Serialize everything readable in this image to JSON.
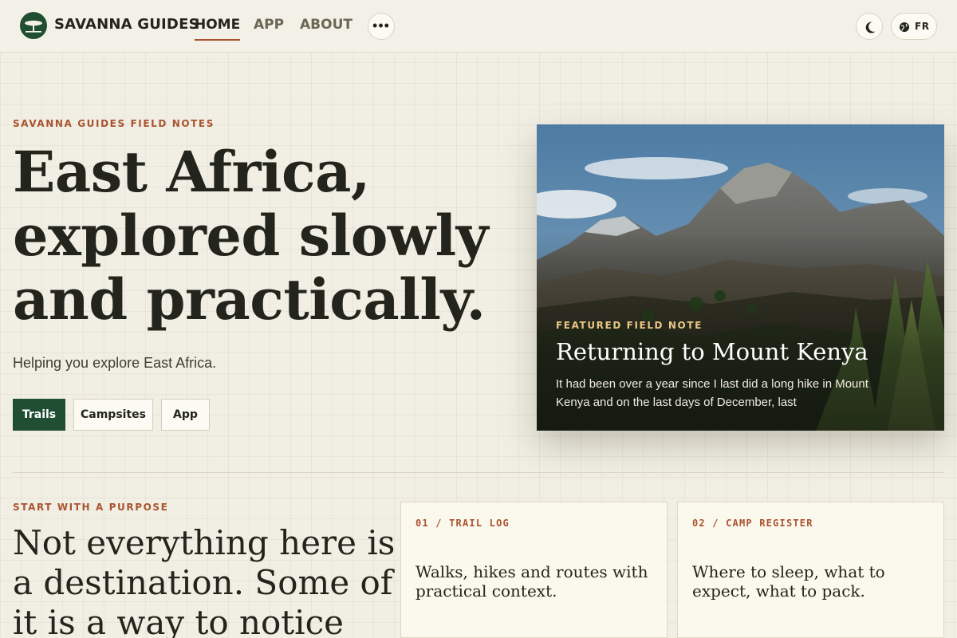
{
  "header": {
    "brand": "SAVANNA GUIDES",
    "nav": [
      {
        "label": "HOME",
        "active": true
      },
      {
        "label": "APP",
        "active": false
      },
      {
        "label": "ABOUT",
        "active": false
      }
    ],
    "more_label": "•••",
    "lang_label": "FR",
    "icons": {
      "logo": "acacia-tree-icon",
      "theme": "moon-icon",
      "lang": "globe-icon",
      "more": "ellipsis-icon"
    }
  },
  "hero": {
    "eyebrow": "SAVANNA GUIDES FIELD NOTES",
    "title_lines": [
      "East Africa,",
      "explored slowly",
      "and practically."
    ],
    "subtitle": "Helping you explore East Africa.",
    "buttons": [
      "Trails",
      "Campsites",
      "App"
    ]
  },
  "featured": {
    "eyebrow": "FEATURED FIELD NOTE",
    "title": "Returning to Mount Kenya",
    "excerpt": "It had been over a year since I last did a long hike in Mount Kenya and on the last days of December, last"
  },
  "purpose": {
    "eyebrow": "START WITH A PURPOSE",
    "lines": [
      "Not everything here is",
      "a destination. Some of",
      "it is a way to notice"
    ]
  },
  "cards": [
    {
      "eyebrow": "01 / TRAIL LOG",
      "text": "Walks, hikes and routes with practical context."
    },
    {
      "eyebrow": "02 / CAMP REGISTER",
      "text": "Where to sleep, what to expect, what to pack."
    }
  ],
  "colors": {
    "accent": "#a9532f",
    "primary": "#1f4e33",
    "background": "#f1efe4",
    "ink": "#23251d"
  }
}
